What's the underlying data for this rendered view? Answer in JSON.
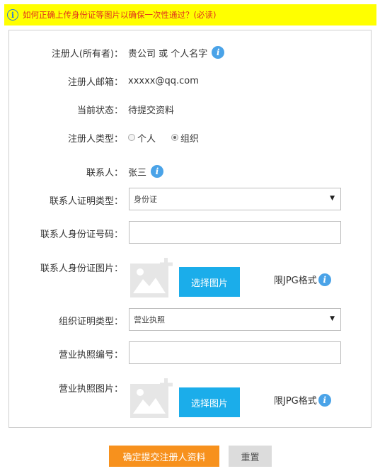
{
  "notice": {
    "text": "如何正确上传身份证等图片以确保一次性通过？(必读)",
    "icon": "info-icon"
  },
  "form": {
    "owner": {
      "label": "注册人(所有者)：",
      "value": "贵公司 或 个人名字"
    },
    "email": {
      "label": "注册人邮箱：",
      "value": "xxxxx@qq.com"
    },
    "status": {
      "label": "当前状态：",
      "value": "待提交资料"
    },
    "type": {
      "label": "注册人类型：",
      "options": [
        "个人",
        "组织"
      ],
      "selected": "组织"
    },
    "contact": {
      "label": "联系人：",
      "value": "张三"
    },
    "contact_id_type": {
      "label": "联系人证明类型：",
      "value": "身份证"
    },
    "contact_id_number": {
      "label": "联系人身份证号码：",
      "value": ""
    },
    "contact_id_image": {
      "label": "联系人身份证图片：",
      "button": "选择图片",
      "hint": "限JPG格式"
    },
    "org_id_type": {
      "label": "组织证明类型：",
      "value": "营业执照"
    },
    "license_number": {
      "label": "营业执照编号：",
      "value": ""
    },
    "license_image": {
      "label": "营业执照图片：",
      "button": "选择图片",
      "hint": "限JPG格式"
    }
  },
  "actions": {
    "submit": "确定提交注册人资料",
    "reset": "重置"
  },
  "colors": {
    "notice_bg": "#ffff00",
    "notice_text": "#e0301e",
    "pick_button": "#1badea",
    "submit_button": "#f7911d",
    "info_icon": "#4aa3e8"
  }
}
